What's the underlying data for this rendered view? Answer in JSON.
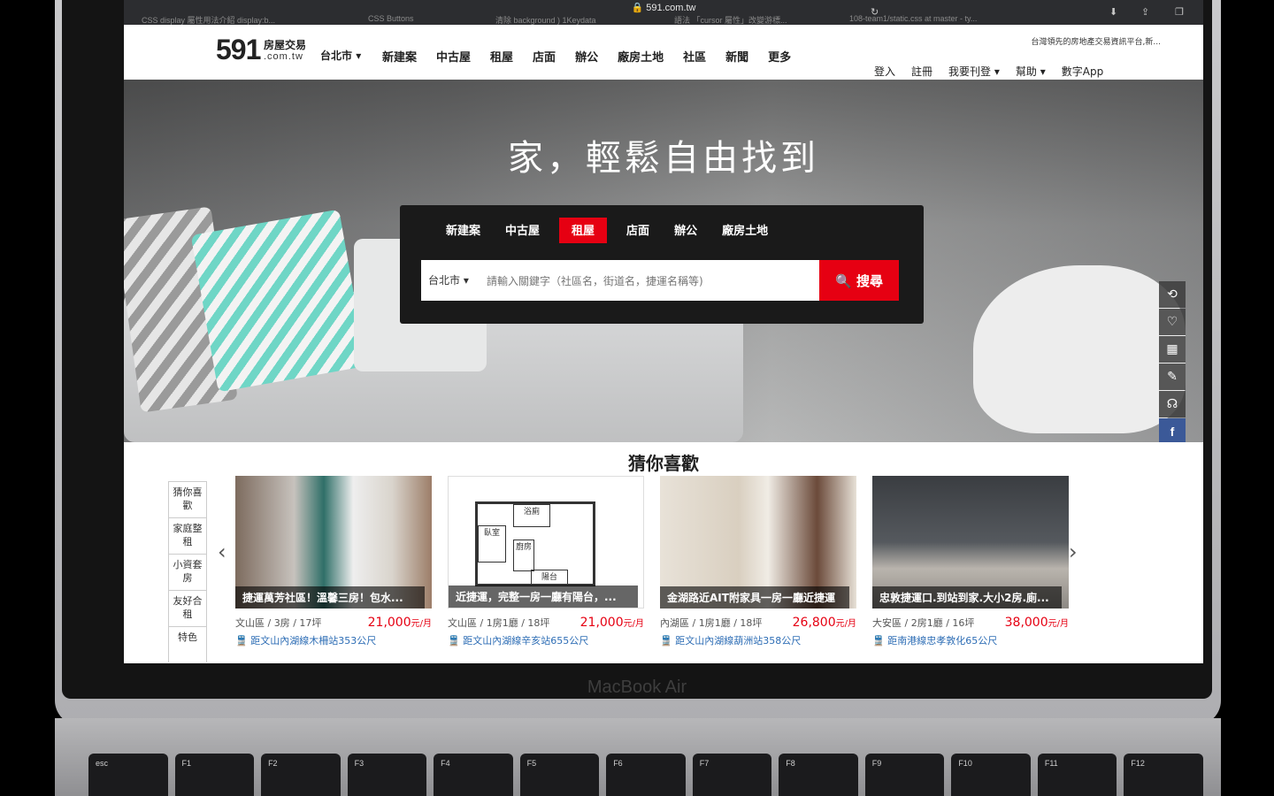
{
  "device": {
    "brand": "MacBook Air"
  },
  "browser": {
    "url": "591.com.tw",
    "tabs": [
      "CSS display 屬性用法介紹 display:b...",
      "CSS Buttons",
      "清除 background ) 1Keydata",
      "語法 「cursor 屬性」改變游標...",
      "108-team1/static.css at master - ty..."
    ]
  },
  "site": {
    "logo_number": "591",
    "logo_cn": "房屋交易",
    "logo_domain": ".com.tw",
    "tagline": "台灣領先的房地產交易資訊平台,新...",
    "city": "台北市",
    "menu": [
      "新建案",
      "中古屋",
      "租屋",
      "店面",
      "辦公",
      "廠房土地",
      "社區",
      "新聞",
      "更多"
    ],
    "right_menu": [
      "登入",
      "註冊",
      "我要刊登",
      "幫助",
      "數字App"
    ]
  },
  "hero": {
    "title": "家，輕鬆自由找到",
    "search_tabs": [
      "新建案",
      "中古屋",
      "租屋",
      "店面",
      "辦公",
      "廠房土地"
    ],
    "active_tab": "租屋",
    "city": "台北市",
    "placeholder": "請輸入關鍵字（社區名，街道名，捷運名稱等)",
    "button": "搜尋"
  },
  "side_tools": [
    "history-icon",
    "heart-icon",
    "qr-icon",
    "edit-icon",
    "headset-icon",
    "facebook-icon"
  ],
  "recommend": {
    "title": "猜你喜歡",
    "categories": [
      "猜你喜歡",
      "家庭整租",
      "小資套房",
      "友好合租",
      "特色"
    ],
    "listings": [
      {
        "title": "捷運萬芳社區！溫馨三房！包水...",
        "district": "文山區",
        "layout": "3房",
        "size": "17坪",
        "price": "21,000",
        "unit": "元/月",
        "mrt": "距文山內湖線木柵站353公尺"
      },
      {
        "title": "近捷運，完整一房一廳有陽台，...",
        "district": "文山區",
        "layout": "1房1廳",
        "size": "18坪",
        "price": "21,000",
        "unit": "元/月",
        "mrt": "距文山內湖線辛亥站655公尺"
      },
      {
        "title": "金湖路近AIT附家具一房一廳近捷運",
        "district": "內湖區",
        "layout": "1房1廳",
        "size": "18坪",
        "price": "26,800",
        "unit": "元/月",
        "mrt": "距文山內湖線葫洲站358公尺"
      },
      {
        "title": "忠敦捷運口.到站到家.大小2房.廁...",
        "district": "大安區",
        "layout": "2房1廳",
        "size": "16坪",
        "price": "38,000",
        "unit": "元/月",
        "mrt": "距南港線忠孝敦化65公尺"
      }
    ],
    "floorplan_labels": [
      "浴廁",
      "臥室",
      "廚房",
      "陽台"
    ]
  },
  "keyboard": [
    "esc",
    "F1",
    "F2",
    "F3",
    "F4",
    "F5",
    "F6",
    "F7",
    "F8",
    "F9",
    "F10",
    "F11",
    "F12"
  ]
}
